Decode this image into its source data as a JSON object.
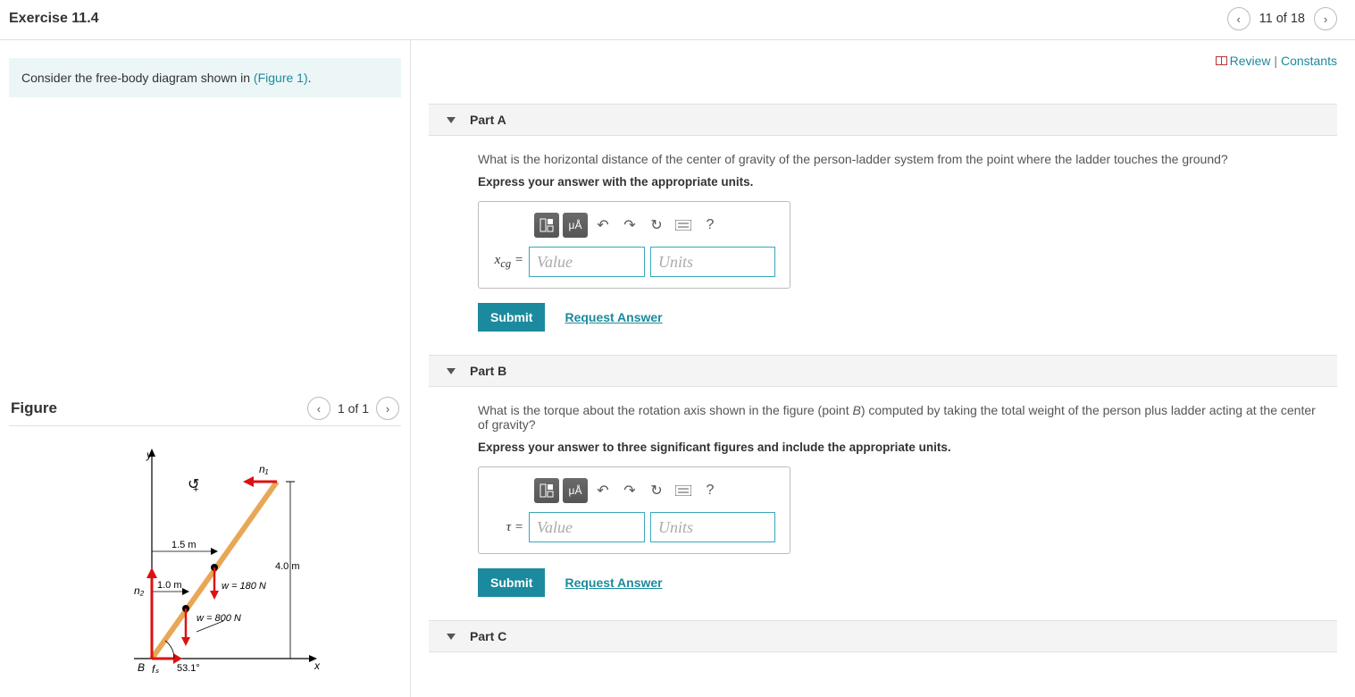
{
  "header": {
    "title": "Exercise 11.4",
    "nav_text": "11 of 18"
  },
  "left": {
    "instruction_prefix": "Consider the free-body diagram shown in ",
    "instruction_link": "(Figure 1)",
    "instruction_suffix": ".",
    "figure_title": "Figure",
    "figure_nav": "1 of 1",
    "diagram": {
      "y_label": "y",
      "x_label": "x",
      "n1_label": "n₁",
      "n2_label": "n₂",
      "B_label": "B",
      "fs_label": "fₛ",
      "dist_1_5": "1.5 m",
      "dist_1_0": "1.0 m",
      "dist_4_0": "4.0 m",
      "w_180": "w = 180 N",
      "w_800": "w = 800 N",
      "angle": "53.1°",
      "rot_symbol": "↺"
    }
  },
  "right": {
    "review": "Review",
    "constants": "Constants",
    "parts": {
      "A": {
        "header": "Part A",
        "question": "What is the horizontal distance of the center of gravity of the person-ladder system from the point where the ladder touches the ground?",
        "instruct": "Express your answer with the appropriate units.",
        "var": "xcg =",
        "value_ph": "Value",
        "units_ph": "Units",
        "submit": "Submit",
        "request": "Request Answer"
      },
      "B": {
        "header": "Part B",
        "question": "What is the torque about the rotation axis shown in the figure (point B) computed by taking the total weight of the person plus ladder acting at the center of gravity?",
        "instruct": "Express your answer to three significant figures and include the appropriate units.",
        "var": "τ =",
        "value_ph": "Value",
        "units_ph": "Units",
        "submit": "Submit",
        "request": "Request Answer"
      },
      "C": {
        "header": "Part C"
      }
    },
    "toolbar": {
      "templates": "□",
      "muA": "μÅ",
      "undo": "↶",
      "redo": "↷",
      "reset": "↻",
      "keyboard": "⌨",
      "help": "?"
    }
  }
}
